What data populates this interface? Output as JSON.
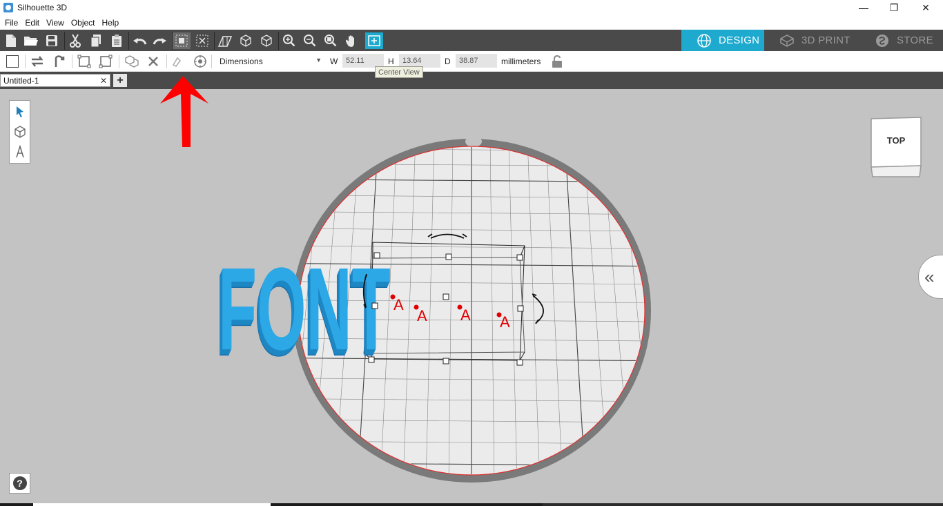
{
  "window": {
    "title": "Silhouette 3D",
    "controls": {
      "minimize": "—",
      "maximize": "❐",
      "close": "✕"
    }
  },
  "menu": [
    "File",
    "Edit",
    "View",
    "Object",
    "Help"
  ],
  "modes": {
    "design": "DESIGN",
    "print": "3D PRINT",
    "store": "STORE",
    "active": "DESIGN",
    "active_color": "#1ea9cf"
  },
  "options": {
    "dimension_mode": "Dimensions",
    "w_label": "W",
    "w_value": "52.11",
    "h_label": "H",
    "h_value": "13.64",
    "d_label": "D",
    "d_value": "38.87",
    "units": "millimeters",
    "tooltip": "Center View"
  },
  "document": {
    "tab_name": "Untitled-1",
    "close_glyph": "✕",
    "add_glyph": "+"
  },
  "scene": {
    "text": "FONT",
    "text_color": "#2da8e6",
    "marker_label": "A",
    "marker_color": "#e00000",
    "bed_border_color": "#777777",
    "annotation_arrow_color": "#ff0000"
  },
  "viewcube": {
    "face_label": "TOP"
  },
  "help": {
    "glyph": "?"
  }
}
